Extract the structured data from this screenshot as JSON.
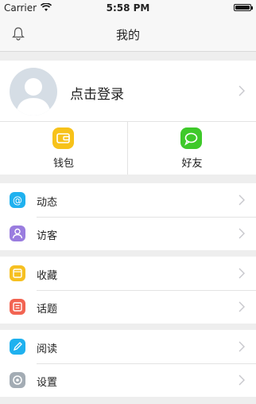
{
  "status": {
    "carrier": "Carrier",
    "time": "5:58 PM"
  },
  "nav": {
    "title": "我的",
    "left_icon": "bell-icon"
  },
  "profile": {
    "login_label": "点击登录"
  },
  "quick_actions": [
    {
      "label": "钱包",
      "icon": "wallet-icon",
      "color": "#f7c21a"
    },
    {
      "label": "好友",
      "icon": "chat-icon",
      "color": "#3ec92a"
    }
  ],
  "groups": [
    {
      "items": [
        {
          "label": "动态",
          "icon": "at-icon",
          "color": "#1fb1ef"
        },
        {
          "label": "访客",
          "icon": "person-icon",
          "color": "#9a7ddf"
        }
      ]
    },
    {
      "items": [
        {
          "label": "收藏",
          "icon": "folder-icon",
          "color": "#f6c021"
        },
        {
          "label": "话题",
          "icon": "list-icon",
          "color": "#f26452"
        }
      ]
    },
    {
      "items": [
        {
          "label": "阅读",
          "icon": "pen-icon",
          "color": "#1fb1ef"
        },
        {
          "label": "设置",
          "icon": "gear-icon",
          "color": "#a3acb4"
        }
      ]
    }
  ]
}
